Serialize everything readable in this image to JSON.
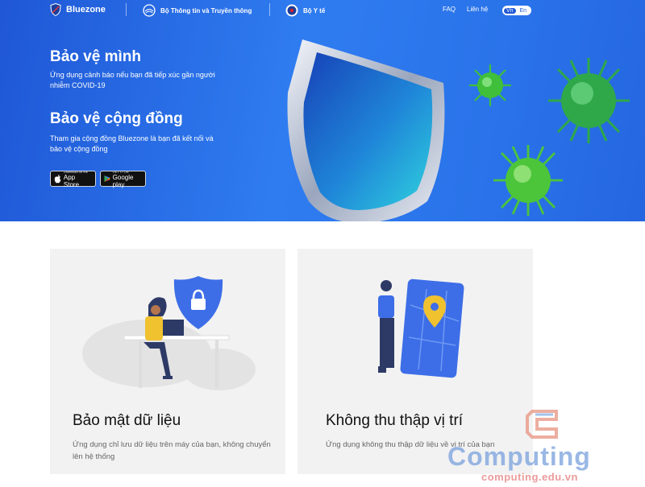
{
  "nav": {
    "brand": "Bluezone",
    "org1": "Bộ Thông tin và Truyền thông",
    "org2": "Bộ Y tế",
    "faq": "FAQ",
    "contact": "Liên hệ",
    "lang_active": "Vn",
    "lang_other": "En"
  },
  "hero": {
    "title1": "Bảo vệ mình",
    "desc1": "Ứng dụng cảnh báo nếu bạn đã tiếp xúc gần người nhiễm COVID-19",
    "title2": "Bảo vệ cộng đồng",
    "desc2": "Tham gia cộng đồng Bluezone là bạn đã kết nối và bảo vệ cộng đồng",
    "appstore_small": "Download on the",
    "appstore_big": "App Store",
    "googleplay_small": "GET IT ON",
    "googleplay_big": "Google play"
  },
  "features": [
    {
      "title": "Bảo mật dữ liệu",
      "desc": "Ứng dụng chỉ lưu dữ liệu trên máy của bạn, không chuyển lên hệ thống"
    },
    {
      "title": "Không thu thập vị trí",
      "desc": "Ứng dụng không thu thập dữ liệu về vị trí của bạn"
    }
  ],
  "watermark": {
    "title": "Computing",
    "url": "computing.edu.vn"
  },
  "colors": {
    "hero_blue": "#2a6fe6",
    "accent_blue": "#3f7be8",
    "virus_green": "#3ec23a"
  }
}
